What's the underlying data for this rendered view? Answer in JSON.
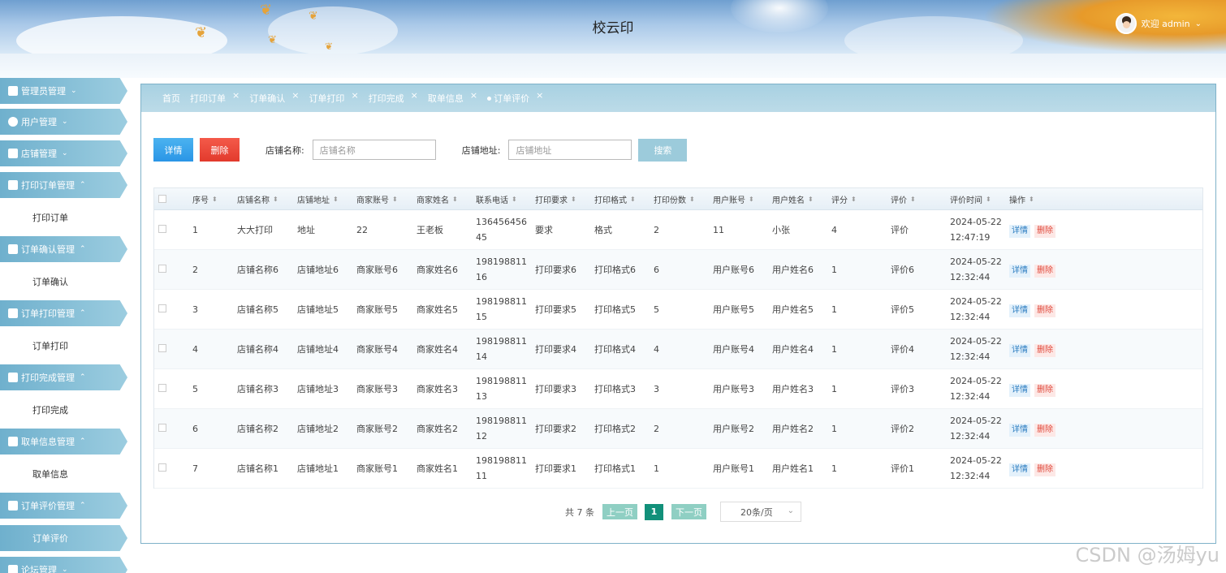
{
  "header": {
    "title": "校云印",
    "welcome": "欢迎 admin"
  },
  "sidebar": {
    "items": [
      {
        "label": "管理员管理",
        "caret": "⌄"
      },
      {
        "label": "用户管理",
        "caret": "⌄"
      },
      {
        "label": "店铺管理",
        "caret": "⌄"
      },
      {
        "label": "打印订单管理",
        "caret": "⌃",
        "sub": "打印订单"
      },
      {
        "label": "订单确认管理",
        "caret": "⌃",
        "sub": "订单确认"
      },
      {
        "label": "订单打印管理",
        "caret": "⌃",
        "sub": "订单打印"
      },
      {
        "label": "打印完成管理",
        "caret": "⌃",
        "sub": "打印完成"
      },
      {
        "label": "取单信息管理",
        "caret": "⌃",
        "sub": "取单信息"
      },
      {
        "label": "订单评价管理",
        "caret": "⌃",
        "sub": "订单评价"
      },
      {
        "label": "论坛管理",
        "caret": "⌄"
      }
    ]
  },
  "tabs": [
    "首页",
    "打印订单",
    "订单确认",
    "订单打印",
    "打印完成",
    "取单信息",
    "订单评价"
  ],
  "toolbar": {
    "detail": "详情",
    "delete": "删除",
    "shop_name_label": "店铺名称:",
    "shop_name_placeholder": "店铺名称",
    "shop_addr_label": "店铺地址:",
    "shop_addr_placeholder": "店铺地址",
    "search": "搜索"
  },
  "table": {
    "headers": [
      "序号",
      "店铺名称",
      "店铺地址",
      "商家账号",
      "商家姓名",
      "联系电话",
      "打印要求",
      "打印格式",
      "打印份数",
      "用户账号",
      "用户姓名",
      "评分",
      "评价",
      "评价时间",
      "操作"
    ],
    "rows": [
      [
        "1",
        "大大打印",
        "地址",
        "22",
        "王老板",
        "13645645645",
        "要求",
        "格式",
        "2",
        "11",
        "小张",
        "4",
        "评价",
        "2024-05-22 12:47:19"
      ],
      [
        "2",
        "店铺名称6",
        "店铺地址6",
        "商家账号6",
        "商家姓名6",
        "19819881116",
        "打印要求6",
        "打印格式6",
        "6",
        "用户账号6",
        "用户姓名6",
        "1",
        "评价6",
        "2024-05-22 12:32:44"
      ],
      [
        "3",
        "店铺名称5",
        "店铺地址5",
        "商家账号5",
        "商家姓名5",
        "19819881115",
        "打印要求5",
        "打印格式5",
        "5",
        "用户账号5",
        "用户姓名5",
        "1",
        "评价5",
        "2024-05-22 12:32:44"
      ],
      [
        "4",
        "店铺名称4",
        "店铺地址4",
        "商家账号4",
        "商家姓名4",
        "19819881114",
        "打印要求4",
        "打印格式4",
        "4",
        "用户账号4",
        "用户姓名4",
        "1",
        "评价4",
        "2024-05-22 12:32:44"
      ],
      [
        "5",
        "店铺名称3",
        "店铺地址3",
        "商家账号3",
        "商家姓名3",
        "19819881113",
        "打印要求3",
        "打印格式3",
        "3",
        "用户账号3",
        "用户姓名3",
        "1",
        "评价3",
        "2024-05-22 12:32:44"
      ],
      [
        "6",
        "店铺名称2",
        "店铺地址2",
        "商家账号2",
        "商家姓名2",
        "19819881112",
        "打印要求2",
        "打印格式2",
        "2",
        "用户账号2",
        "用户姓名2",
        "1",
        "评价2",
        "2024-05-22 12:32:44"
      ],
      [
        "7",
        "店铺名称1",
        "店铺地址1",
        "商家账号1",
        "商家姓名1",
        "19819881111",
        "打印要求1",
        "打印格式1",
        "1",
        "用户账号1",
        "用户姓名1",
        "1",
        "评价1",
        "2024-05-22 12:32:44"
      ]
    ],
    "row_detail": "详情",
    "row_delete": "删除"
  },
  "pager": {
    "total": "共 7 条",
    "prev": "上一页",
    "page": "1",
    "next": "下一页",
    "size": "20条/页"
  },
  "watermark": "CSDN @汤姆yu"
}
